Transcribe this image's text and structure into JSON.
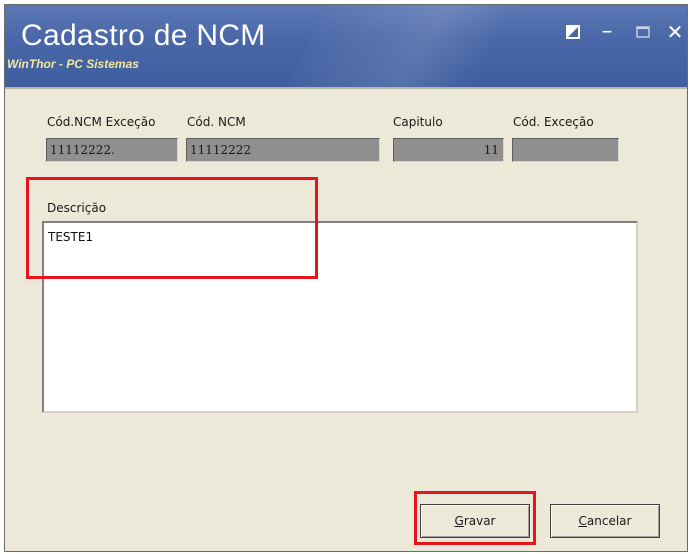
{
  "window": {
    "title": "Cadastro de NCM",
    "subtitle": "WinThor - PC Sistemas",
    "controls": {
      "minimize": "–",
      "close": "✕"
    }
  },
  "form": {
    "cod_ncm_excecao": {
      "label": "Cód.NCM Exceção",
      "value": "11112222."
    },
    "cod_ncm": {
      "label": "Cód. NCM",
      "value": "11112222"
    },
    "capitulo": {
      "label": "Capitulo",
      "value": "11"
    },
    "cod_excecao": {
      "label": "Cód. Exceção",
      "value": ""
    },
    "descricao": {
      "label": "Descrição",
      "value": "TESTE1"
    }
  },
  "buttons": {
    "gravar": {
      "accel": "G",
      "rest": "ravar"
    },
    "cancelar": {
      "accel": "C",
      "rest": "ancelar"
    }
  },
  "highlight_color": "#e8141c",
  "field_color": "#8f8f8f"
}
